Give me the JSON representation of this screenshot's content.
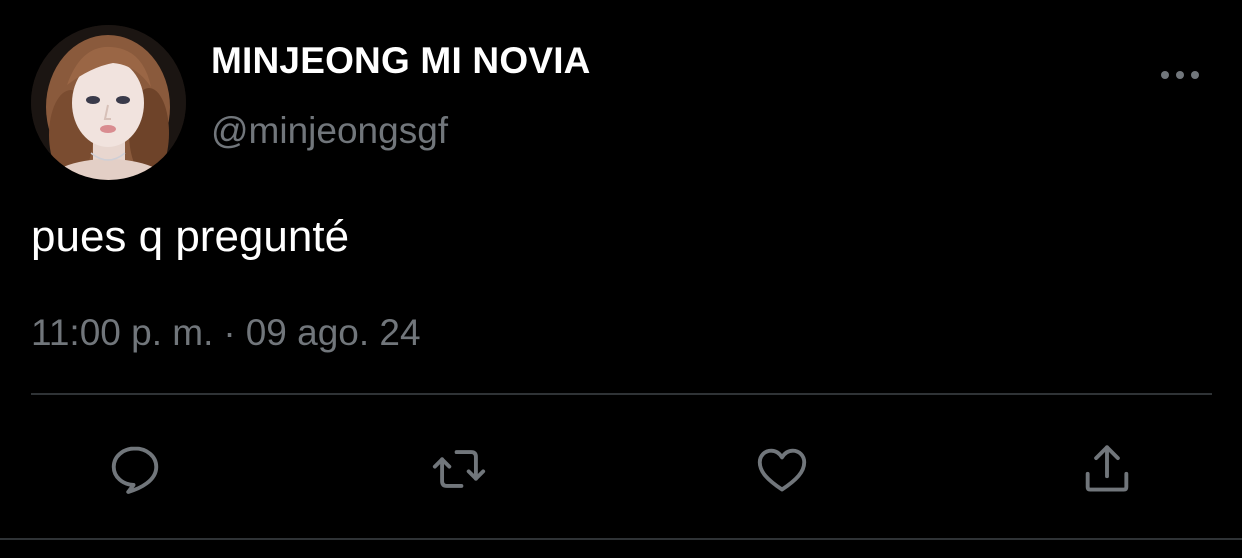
{
  "tweet": {
    "author": {
      "display_name": "MINJEONG MI NOVIA",
      "handle": "@minjeongsgf",
      "avatar_icon": "profile-photo"
    },
    "text": "pues q pregunté",
    "time": "11:00 p. m.",
    "separator": "·",
    "date": "09 ago. 24",
    "more_icon": "more-horizontal-icon"
  },
  "actions": [
    {
      "icon": "reply-icon"
    },
    {
      "icon": "retweet-icon"
    },
    {
      "icon": "like-heart-icon"
    },
    {
      "icon": "share-icon"
    }
  ],
  "colors": {
    "background": "#000000",
    "primary_text": "#ffffff",
    "secondary_text": "#71767b",
    "divider": "#2f3336"
  }
}
